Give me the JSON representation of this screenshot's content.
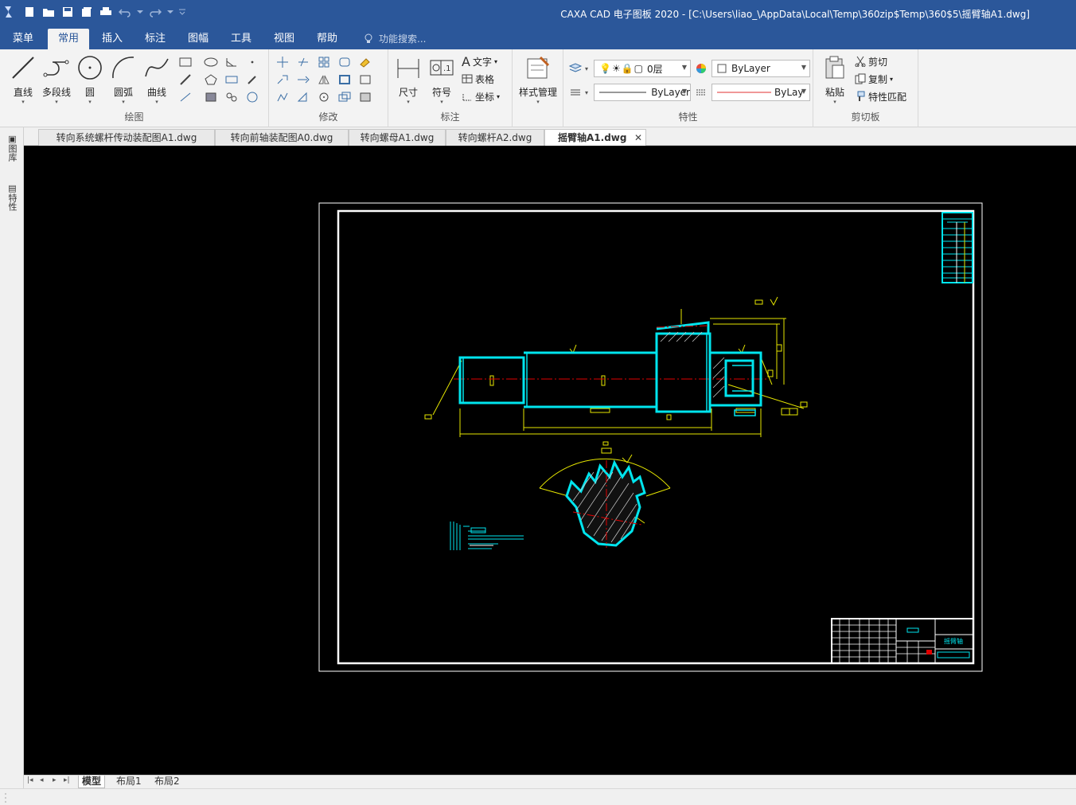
{
  "window": {
    "title": "CAXA CAD 电子图板 2020 - [C:\\Users\\liao_\\AppData\\Local\\Temp\\360zip$Temp\\360$5\\摇臂轴A1.dwg]"
  },
  "menu": {
    "tabs": [
      "菜单",
      "常用",
      "插入",
      "标注",
      "图幅",
      "工具",
      "视图",
      "帮助"
    ],
    "active": "常用",
    "search_placeholder": "功能搜索..."
  },
  "ribbon": {
    "draw": {
      "label": "绘图",
      "line": "直线",
      "polyline": "多段线",
      "circle": "圆",
      "arc": "圆弧",
      "curve": "曲线"
    },
    "modify": {
      "label": "修改"
    },
    "annotate": {
      "label": "标注",
      "dimension": "尺寸",
      "symbol": "符号",
      "text": "文字",
      "table": "表格",
      "coordinate": "坐标"
    },
    "style": {
      "label": "样式管理"
    },
    "properties": {
      "label": "特性",
      "layer": "0层",
      "color": "ByLayer",
      "linetype": "ByLayer",
      "lineweight": "ByLay"
    },
    "clipboard": {
      "label": "剪切板",
      "paste": "粘贴",
      "cut": "剪切",
      "copy": "复制",
      "match": "特性匹配"
    }
  },
  "documents": {
    "tabs": [
      "转向系统螺杆传动装配图A1.dwg",
      "转向前轴装配图A0.dwg",
      "转向螺母A1.dwg",
      "转向螺杆A2.dwg",
      "摇臂轴A1.dwg"
    ],
    "active": "摇臂轴A1.dwg",
    "close_glyph": "✕"
  },
  "side_panels": {
    "library": "图库",
    "properties": "特性"
  },
  "layout_tabs": {
    "items": [
      "模型",
      "布局1",
      "布局2"
    ],
    "active": "模型"
  },
  "drawing": {
    "title_block_name": "摇臂轴"
  },
  "colors": {
    "title_bar": "#2b579a",
    "ribbon_bg": "#f3f3f3",
    "canvas_bg": "#000000",
    "outline": "#00e5ee",
    "dimension": "#e6e600",
    "centerline": "#e00000",
    "frame": "#ffffff"
  }
}
